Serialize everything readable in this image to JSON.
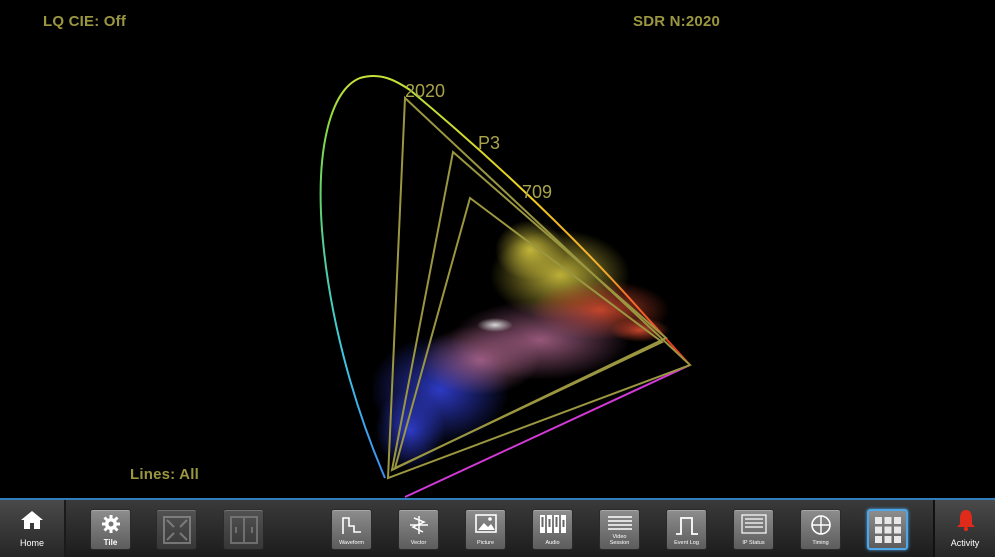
{
  "status": {
    "lq_cie": "LQ CIE: Off",
    "sdr": "SDR N:2020",
    "lines": "Lines: All"
  },
  "gamuts": {
    "rec2020": "2020",
    "p3": "P3",
    "rec709": "709"
  },
  "toolbar": {
    "home": "Home",
    "tile": "Tile",
    "buttons": [
      {
        "label": "Waveform"
      },
      {
        "label": "Vector"
      },
      {
        "label": "Picture"
      },
      {
        "label": "Audio"
      },
      {
        "label": "Video\nSession"
      },
      {
        "label": "Event Log"
      },
      {
        "label": "IP Status"
      },
      {
        "label": "Timing"
      }
    ],
    "activity": "Activity"
  },
  "colors": {
    "accent": "#2f7fbf",
    "gamut_line": "#9b9640",
    "alert": "#e02a1a"
  }
}
